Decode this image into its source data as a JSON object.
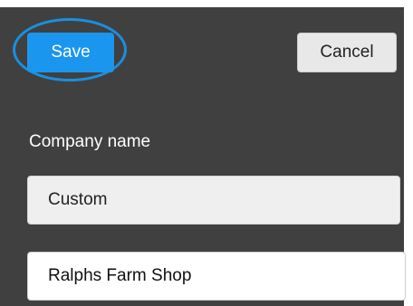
{
  "toolbar": {
    "save_label": "Save",
    "cancel_label": "Cancel"
  },
  "form": {
    "company_name_label": "Company name",
    "company_type_value": "Custom",
    "company_name_value": "Ralphs Farm Shop"
  },
  "colors": {
    "panel_background": "#404040",
    "save_button": "#1a96ee",
    "highlight_ring": "#1a8fe0"
  }
}
